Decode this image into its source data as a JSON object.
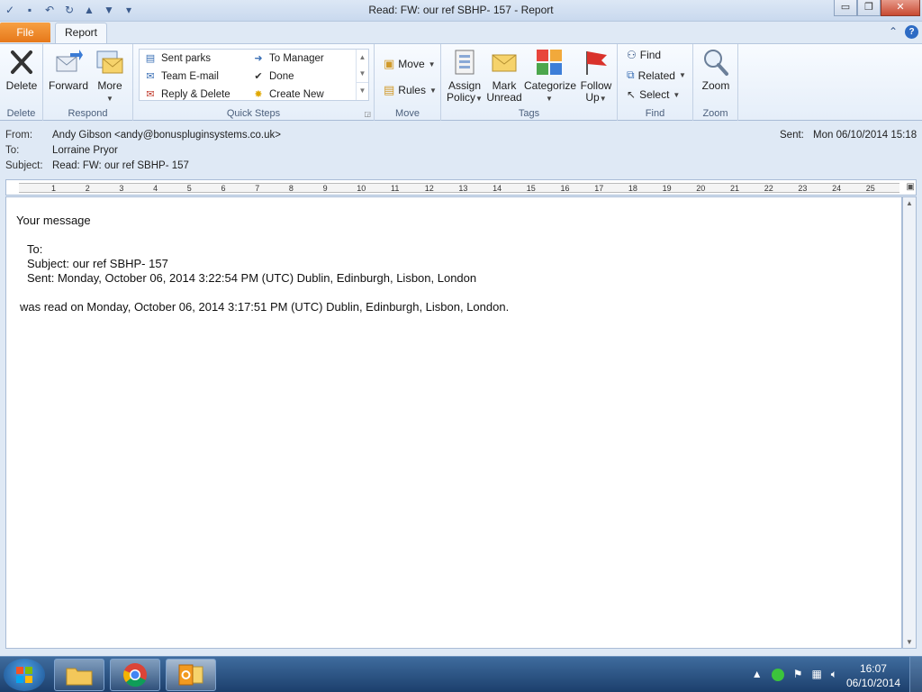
{
  "window": {
    "title": "Read: FW: our ref SBHP- 157  -  Report",
    "min": "▭",
    "max": "❐",
    "close": "✕"
  },
  "tabs": {
    "file": "File",
    "report": "Report"
  },
  "ribbon": {
    "delete": {
      "label": "Delete",
      "group": "Delete"
    },
    "respond": {
      "forward": "Forward",
      "more": "More",
      "group": "Respond"
    },
    "quick_steps": {
      "group": "Quick Steps",
      "items": [
        "Sent parks",
        "To Manager",
        "Team E-mail",
        "Done",
        "Reply & Delete",
        "Create New"
      ]
    },
    "move": {
      "move": "Move",
      "rules": "Rules",
      "group": "Move"
    },
    "tags": {
      "assign_1": "Assign",
      "assign_2": "Policy",
      "mark_1": "Mark",
      "mark_2": "Unread",
      "categorize": "Categorize",
      "follow_1": "Follow",
      "follow_2": "Up",
      "group": "Tags"
    },
    "find": {
      "find": "Find",
      "related": "Related",
      "select": "Select",
      "group": "Find"
    },
    "zoom": {
      "label": "Zoom",
      "group": "Zoom"
    }
  },
  "header": {
    "from_label": "From:",
    "from_value": "Andy Gibson <andy@bonuspluginsystems.co.uk>",
    "to_label": "To:",
    "to_value": "Lorraine Pryor",
    "subject_label": "Subject:",
    "subject_value": "Read: FW: our ref SBHP- 157",
    "sent_label": "Sent:",
    "sent_value": "Mon 06/10/2014 15:18"
  },
  "ruler": [
    "1",
    "2",
    "3",
    "4",
    "5",
    "6",
    "7",
    "8",
    "9",
    "10",
    "11",
    "12",
    "13",
    "14",
    "15",
    "16",
    "17",
    "18",
    "19",
    "20",
    "21",
    "22",
    "23",
    "24",
    "25"
  ],
  "message": {
    "line1": "Your message",
    "to": "To:",
    "subject": "Subject: our ref SBHP- 157",
    "sent": "Sent: Monday, October 06, 2014 3:22:54 PM (UTC) Dublin, Edinburgh, Lisbon, London",
    "read": "was read on Monday, October 06, 2014 3:17:51 PM (UTC) Dublin, Edinburgh, Lisbon, London."
  },
  "taskbar": {
    "time": "16:07",
    "date": "06/10/2014"
  }
}
